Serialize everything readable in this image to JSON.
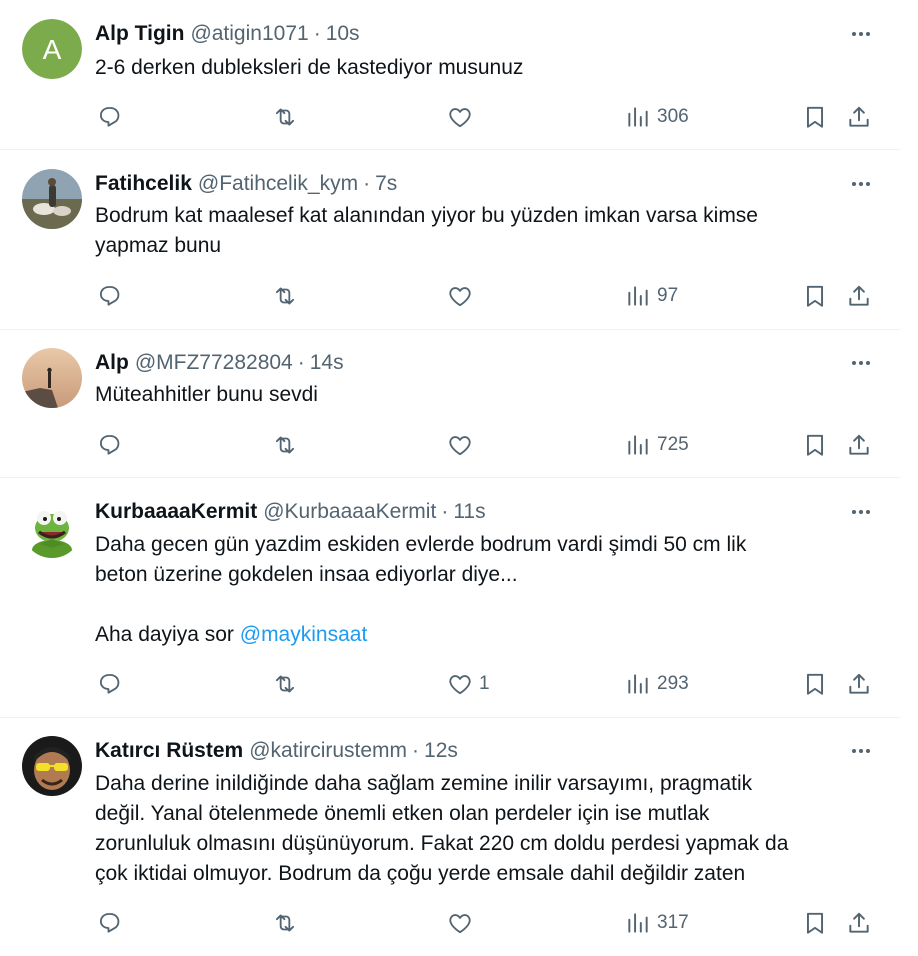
{
  "tweets": [
    {
      "name": "Alp Tigin",
      "handle": "@atigin1071",
      "time": "10s",
      "avatar": {
        "type": "letter",
        "letter": "A",
        "color": "#7cab4c"
      },
      "lines": [
        "2-6 derken dubleksleri de kastediyor musunuz"
      ],
      "likes": "",
      "views": "306"
    },
    {
      "name": "Fatihcelik",
      "handle": "@Fatihcelik_kym",
      "time": "7s",
      "avatar": {
        "type": "photo",
        "desc": "person-with-sheep"
      },
      "lines": [
        "Bodrum kat maalesef kat alanından yiyor bu yüzden imkan varsa kimse",
        "yapmaz bunu"
      ],
      "likes": "",
      "views": "97"
    },
    {
      "name": "Alp",
      "handle": "@MFZ77282804",
      "time": "14s",
      "avatar": {
        "type": "photo",
        "desc": "figure-on-cliff-at-dusk"
      },
      "lines": [
        "Müteahhitler bunu sevdi"
      ],
      "likes": "",
      "views": "725"
    },
    {
      "name": "KurbaaaaKermit",
      "handle": "@KurbaaaaKermit",
      "time": "11s",
      "avatar": {
        "type": "photo",
        "desc": "kermit-the-frog"
      },
      "lines": [
        "Daha gecen gün yazdim eskiden evlerde bodrum vardi şimdi 50 cm lik",
        "beton üzerine gokdelen insaa ediyorlar diye...",
        "",
        "Aha dayiya sor "
      ],
      "mention": "@maykinsaat",
      "likes": "1",
      "views": "293"
    },
    {
      "name": "Katırcı Rüstem",
      "handle": "@katircirustemm",
      "time": "12s",
      "avatar": {
        "type": "photo",
        "desc": "man-with-yellow-sunglasses"
      },
      "lines": [
        "Daha derine inildiğinde daha sağlam zemine inilir varsayımı, pragmatik",
        "değil. Yanal ötelenmede önemli etken olan perdeler için ise mutlak",
        "zorunluluk olmasını düşünüyorum. Fakat 220 cm doldu perdesi yapmak da",
        "çok iktidai olmuyor. Bodrum da çoğu yerde emsale dahil değildir zaten"
      ],
      "likes": "",
      "views": "317"
    }
  ],
  "icons": {
    "more": "more-dots-icon",
    "reply": "reply-icon",
    "retweet": "retweet-icon",
    "like": "heart-icon",
    "views": "views-chart-icon",
    "bookmark": "bookmark-icon",
    "share": "share-icon"
  },
  "colors": {
    "text": "#0f1419",
    "secondary": "#536471",
    "mention": "#1d9bf0",
    "divider": "#eff3f4"
  }
}
